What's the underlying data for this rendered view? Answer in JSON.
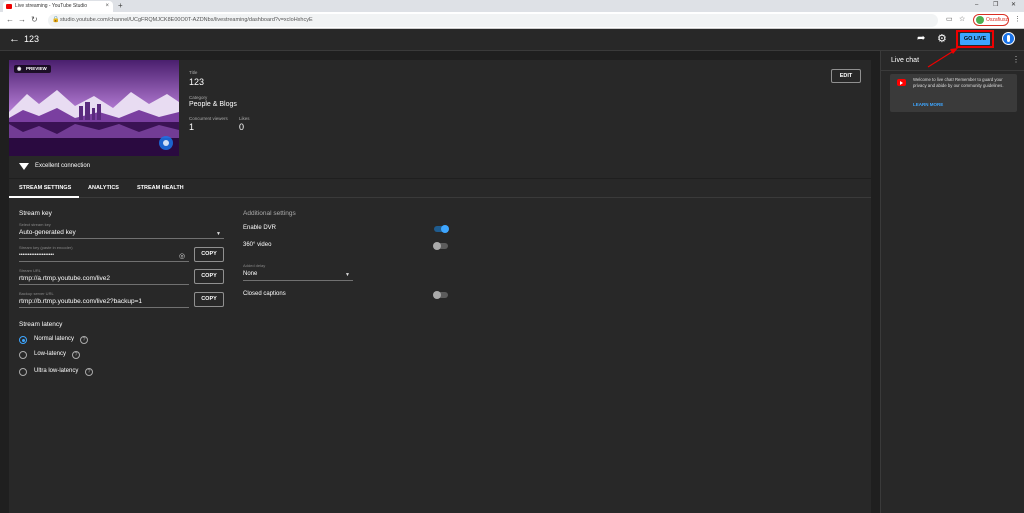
{
  "browser": {
    "tab_title": "Live streaming - YouTube Studio",
    "tab_close": "×",
    "new_tab": "+",
    "url": "studio.youtube.com/channel/UCgFRQMJCK8E00O0T-AZDNbs/livestreaming/dashboard?v=xcloHxhcyE",
    "profile_label": "Oszafiusz",
    "win_min": "–",
    "win_max": "❐",
    "win_close": "✕"
  },
  "header": {
    "title": "123",
    "go_live_label": "GO LIVE"
  },
  "preview": {
    "badge": "PREVIEW",
    "connection": "Excellent connection"
  },
  "details": {
    "title_label": "Title",
    "title_value": "123",
    "category_label": "Category",
    "category_value": "People & Blogs",
    "viewers_label": "Concurrent viewers",
    "viewers_value": "1",
    "likes_label": "Likes",
    "likes_value": "0",
    "edit_label": "EDIT"
  },
  "tabs": [
    "STREAM SETTINGS",
    "ANALYTICS",
    "STREAM HEALTH"
  ],
  "stream_key": {
    "section_title": "Stream key",
    "select_label": "Select stream key",
    "select_value": "Auto-generated key",
    "key_label": "Stream key (paste in encoder)",
    "key_value": "••••••••••••••••••••",
    "url_label": "Stream URL",
    "url_value": "rtmp://a.rtmp.youtube.com/live2",
    "backup_label": "Backup server URL",
    "backup_value": "rtmp://b.rtmp.youtube.com/live2?backup=1",
    "copy_label": "COPY"
  },
  "latency": {
    "section_title": "Stream latency",
    "options": [
      "Normal latency",
      "Low-latency",
      "Ultra low-latency"
    ],
    "selected_index": 0
  },
  "additional": {
    "section_title": "Additional settings",
    "dvr_label": "Enable DVR",
    "dvr_on": true,
    "video360_label": "360° video",
    "video360_on": false,
    "delay_label": "Added delay",
    "delay_value": "None",
    "captions_label": "Closed captions",
    "captions_on": false
  },
  "chat": {
    "title": "Live chat",
    "message": "Welcome to live chat! Remember to guard your privacy and abide by our community guidelines.",
    "learn_more": "LEARN MORE"
  },
  "colors": {
    "accent": "#3ea6ff",
    "highlight": "#ee0000"
  }
}
